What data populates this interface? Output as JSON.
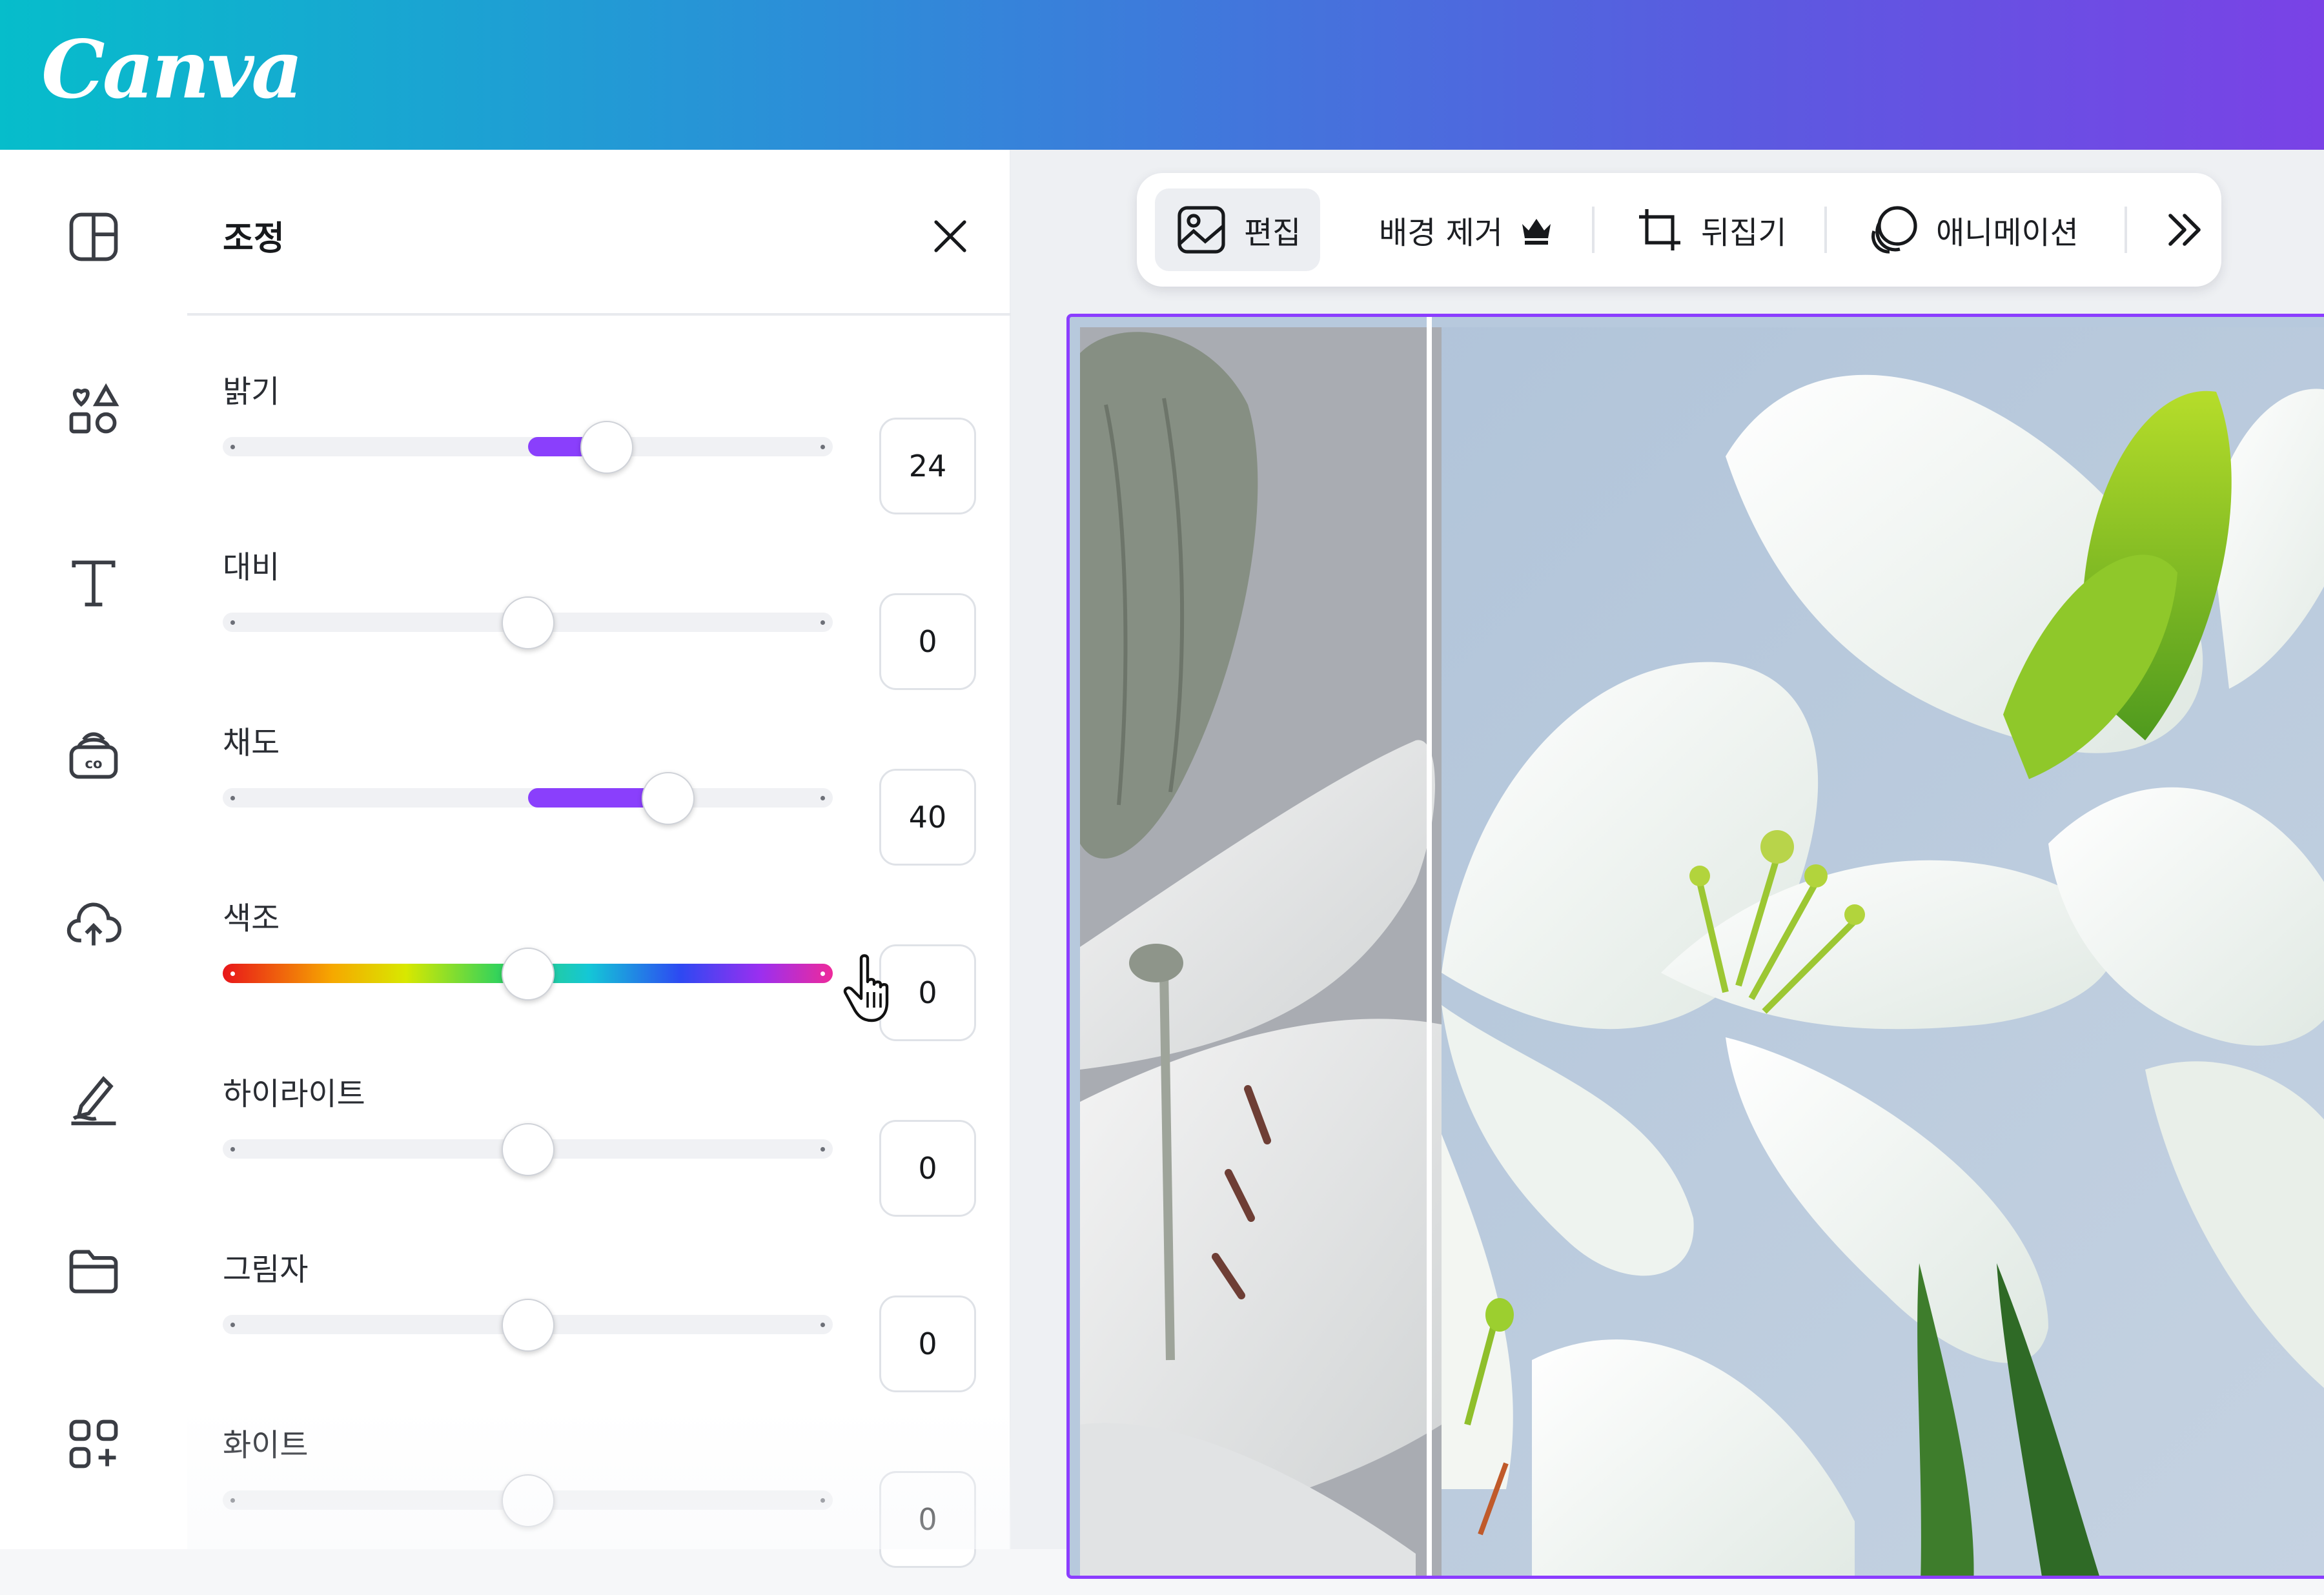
{
  "app": {
    "logo_text": "Canva"
  },
  "colors": {
    "accent": "#8a3ffc",
    "selection": "#8b3dff",
    "panel_bg": "#ffffff",
    "canvas_bg": "#eef0f3"
  },
  "rail": {
    "items": [
      {
        "icon": "layout-icon"
      },
      {
        "icon": "elements-icon"
      },
      {
        "icon": "text-icon"
      },
      {
        "icon": "brand-icon"
      },
      {
        "icon": "upload-cloud-icon"
      },
      {
        "icon": "draw-icon"
      },
      {
        "icon": "folder-icon"
      },
      {
        "icon": "apps-icon"
      }
    ]
  },
  "panel": {
    "title": "조정",
    "close_icon": "close-icon",
    "adjustments": [
      {
        "label": "밝기",
        "value": "24",
        "fill_from": 0.5,
        "fill_to": 0.63
      },
      {
        "label": "대비",
        "value": "0",
        "fill_from": 0.5,
        "fill_to": 0.5
      },
      {
        "label": "채도",
        "value": "40",
        "fill_from": 0.5,
        "fill_to": 0.73
      },
      {
        "label": "색조",
        "value": "0",
        "fill_from": 0.5,
        "fill_to": 0.5,
        "hue": true
      },
      {
        "label": "하이라이트",
        "value": "0",
        "fill_from": 0.5,
        "fill_to": 0.5
      },
      {
        "label": "그림자",
        "value": "0",
        "fill_from": 0.5,
        "fill_to": 0.5
      },
      {
        "label": "화이트",
        "value": "0",
        "fill_from": 0.5,
        "fill_to": 0.5
      }
    ]
  },
  "toolbar": {
    "edit_label": "편집",
    "bg_remove_label": "배경 제거",
    "flip_label": "뒤집기",
    "animate_label": "애니메이션"
  }
}
